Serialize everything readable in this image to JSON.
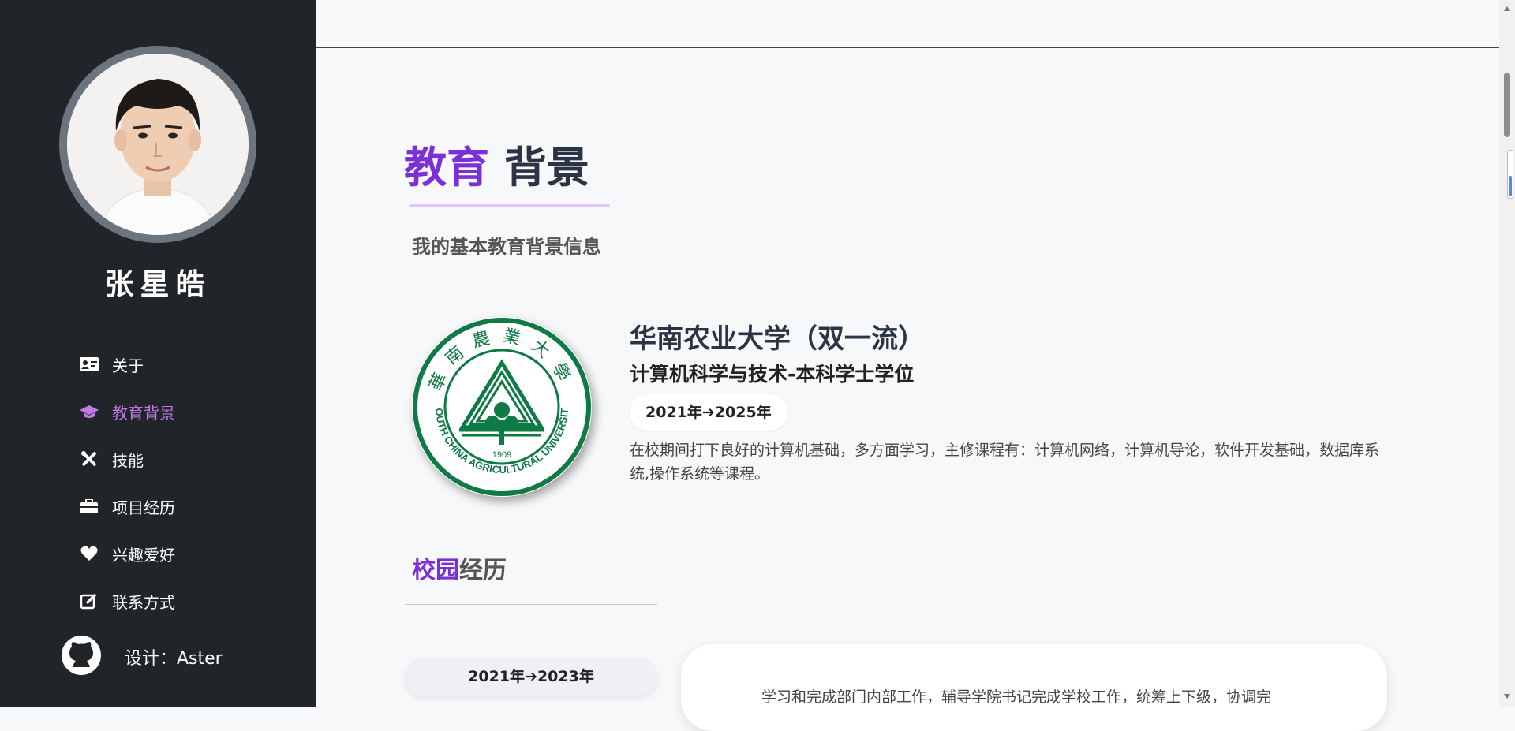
{
  "sidebar": {
    "name": "张星皓",
    "nav": [
      {
        "label": "关于",
        "icon": "id-card-icon"
      },
      {
        "label": "教育背景",
        "icon": "graduation-cap-icon",
        "active": true
      },
      {
        "label": "技能",
        "icon": "tools-icon"
      },
      {
        "label": "项目经历",
        "icon": "briefcase-icon"
      },
      {
        "label": "兴趣爱好",
        "icon": "heart-icon"
      },
      {
        "label": "联系方式",
        "icon": "edit-icon"
      }
    ],
    "footer": {
      "label": "设计：Aster",
      "icon": "github-icon"
    }
  },
  "main": {
    "title_accent": "教育",
    "title_rest": " 背景",
    "subtitle": "我的基本教育背景信息",
    "education": {
      "school": "华南农业大学（双一流）",
      "degree": "计算机科学与技术-本科学士学位",
      "dates": "2021年➔2025年",
      "description": "在校期间打下良好的计算机基础，多方面学习，主修课程有：计算机网络，计算机导论，软件开发基础，数据库系统,操作系统等课程。",
      "logo": {
        "year": "1909",
        "english": "SOUTH CHINA AGRICULTURAL UNIVERSITY",
        "chinese": "華南農業大學"
      }
    },
    "campus": {
      "title_accent": "校园",
      "title_rest": "经历",
      "dates": "2021年➔2023年",
      "text": "学习和完成部门内部工作，辅导学院书记完成学校工作，统筹上下级，协调完"
    }
  },
  "colors": {
    "sidebar_bg": "#212429",
    "accent": "#7b2fd6",
    "nav_active": "#c07ae8",
    "logo_green": "#0e7a45"
  }
}
